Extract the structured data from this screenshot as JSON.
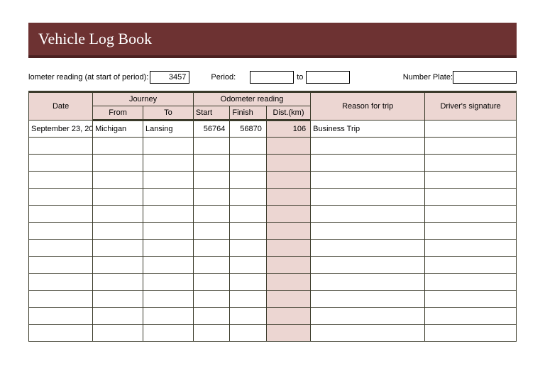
{
  "title": "Vehicle Log Book",
  "meta": {
    "odometer_label": "lometer reading (at start of period):",
    "odometer_value": "3457",
    "period_label": "Period:",
    "period_from": "",
    "period_to_label": "to",
    "period_to": "",
    "plate_label": "Number Plate:",
    "plate_value": ""
  },
  "headers": {
    "date": "Date",
    "journey": "Journey",
    "from": "From",
    "to": "To",
    "odometer": "Odometer reading",
    "start": "Start",
    "finish": "Finish",
    "dist": "Dist.(km)",
    "reason": "Reason for trip",
    "sig": "Driver's signature"
  },
  "rows": [
    {
      "date": "September 23, 20",
      "from": "Michigan",
      "to": "Lansing",
      "start": "56764",
      "finish": "56870",
      "dist": "106",
      "reason": "Business Trip",
      "sig": ""
    },
    {
      "date": "",
      "from": "",
      "to": "",
      "start": "",
      "finish": "",
      "dist": "",
      "reason": "",
      "sig": ""
    },
    {
      "date": "",
      "from": "",
      "to": "",
      "start": "",
      "finish": "",
      "dist": "",
      "reason": "",
      "sig": ""
    },
    {
      "date": "",
      "from": "",
      "to": "",
      "start": "",
      "finish": "",
      "dist": "",
      "reason": "",
      "sig": ""
    },
    {
      "date": "",
      "from": "",
      "to": "",
      "start": "",
      "finish": "",
      "dist": "",
      "reason": "",
      "sig": ""
    },
    {
      "date": "",
      "from": "",
      "to": "",
      "start": "",
      "finish": "",
      "dist": "",
      "reason": "",
      "sig": ""
    },
    {
      "date": "",
      "from": "",
      "to": "",
      "start": "",
      "finish": "",
      "dist": "",
      "reason": "",
      "sig": ""
    },
    {
      "date": "",
      "from": "",
      "to": "",
      "start": "",
      "finish": "",
      "dist": "",
      "reason": "",
      "sig": ""
    },
    {
      "date": "",
      "from": "",
      "to": "",
      "start": "",
      "finish": "",
      "dist": "",
      "reason": "",
      "sig": ""
    },
    {
      "date": "",
      "from": "",
      "to": "",
      "start": "",
      "finish": "",
      "dist": "",
      "reason": "",
      "sig": ""
    },
    {
      "date": "",
      "from": "",
      "to": "",
      "start": "",
      "finish": "",
      "dist": "",
      "reason": "",
      "sig": ""
    },
    {
      "date": "",
      "from": "",
      "to": "",
      "start": "",
      "finish": "",
      "dist": "",
      "reason": "",
      "sig": ""
    },
    {
      "date": "",
      "from": "",
      "to": "",
      "start": "",
      "finish": "",
      "dist": "",
      "reason": "",
      "sig": ""
    }
  ]
}
